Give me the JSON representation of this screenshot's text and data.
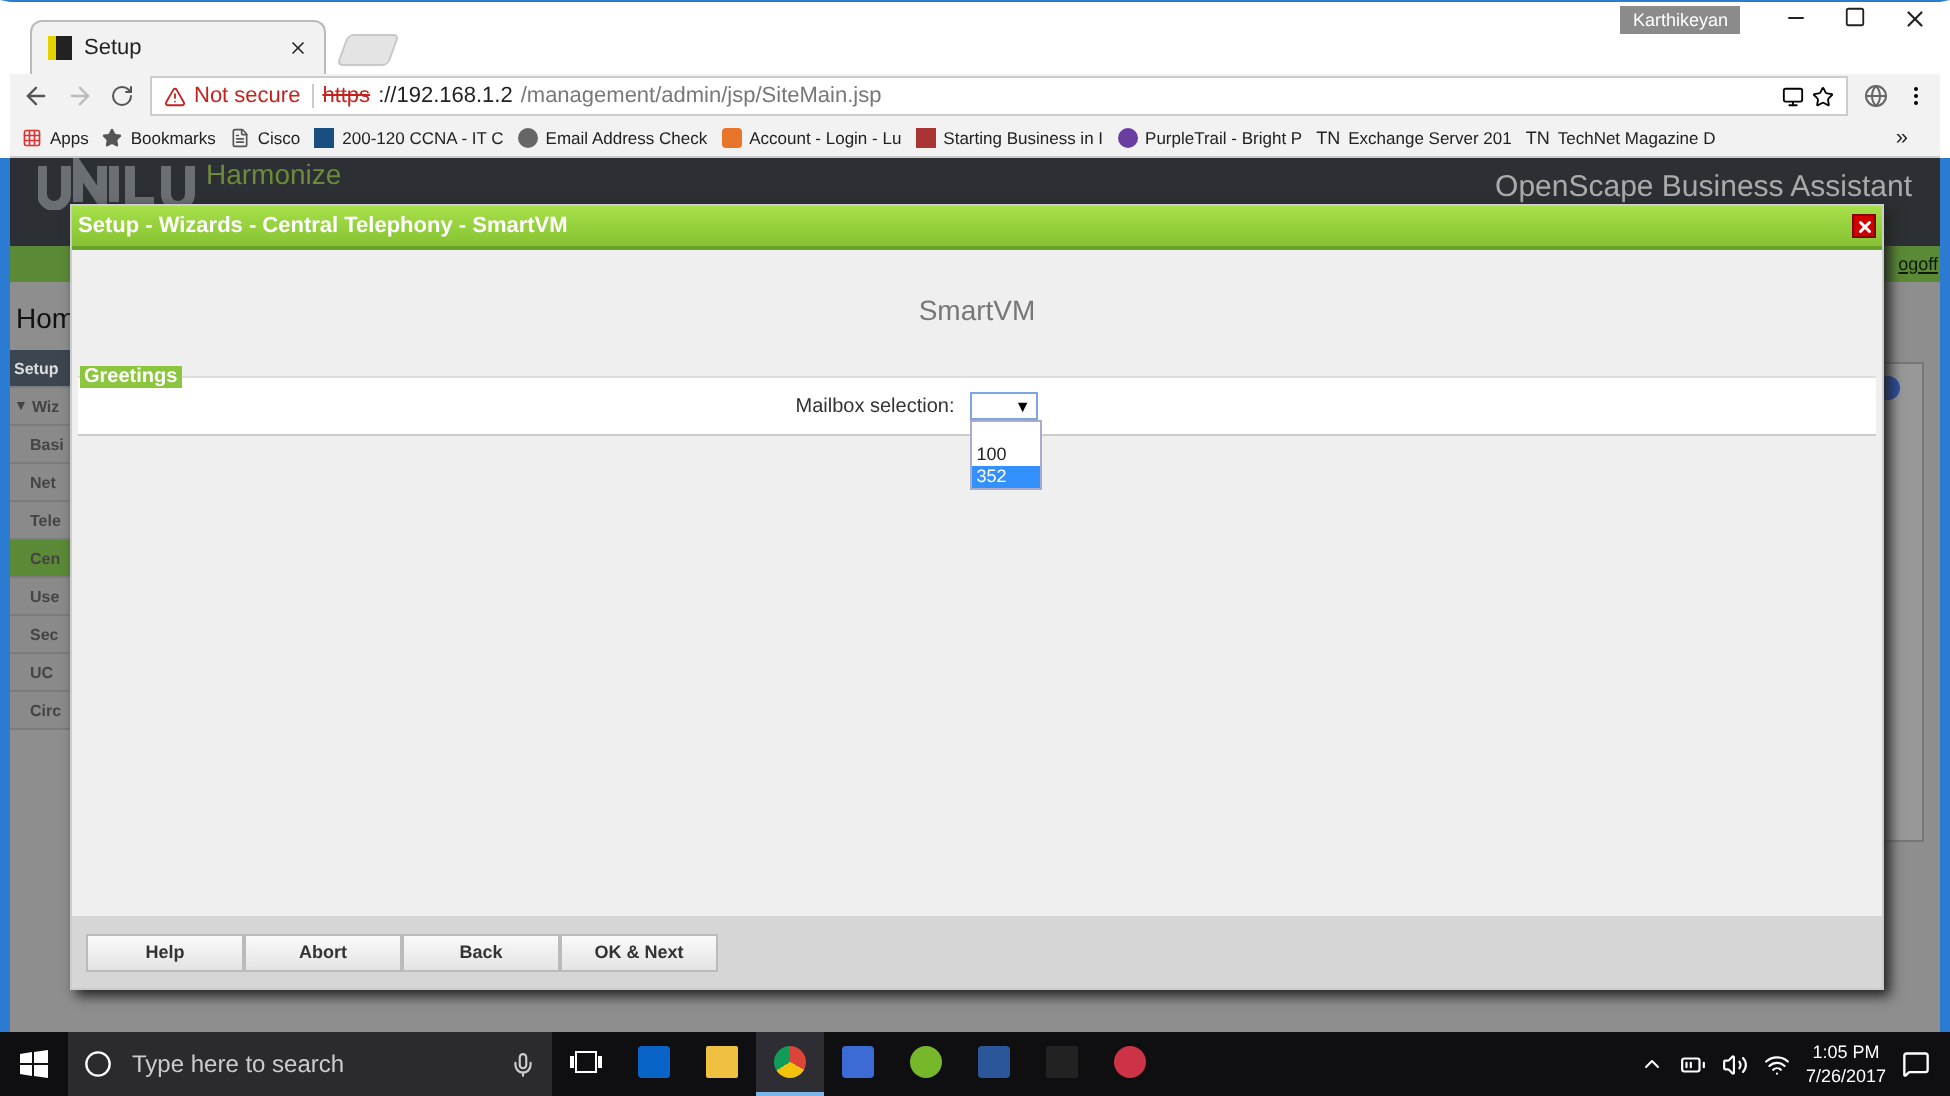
{
  "browser": {
    "tab": {
      "title": "Setup",
      "selected": true
    },
    "user": "Karthikeyan",
    "address": {
      "security": "Not secure",
      "scheme": "https",
      "host": "://192.168.1.2",
      "path": "/management/admin/jsp/SiteMain.jsp"
    },
    "bookmarks": [
      {
        "label": "Apps",
        "kind": "apps"
      },
      {
        "label": "Bookmarks",
        "kind": "folder"
      },
      {
        "label": "Cisco",
        "kind": "page"
      },
      {
        "label": "200-120 CCNA - IT C",
        "kind": "cisco"
      },
      {
        "label": "Email Address Check",
        "kind": "blob"
      },
      {
        "label": "Account - Login - Lu",
        "kind": "orange"
      },
      {
        "label": "Starting Business in I",
        "kind": "tee"
      },
      {
        "label": "PurpleTrail - Bright P",
        "kind": "flower"
      },
      {
        "label": "Exchange Server 201",
        "icon_text": "TN"
      },
      {
        "label": "TechNet Magazine D",
        "icon_text": "TN"
      }
    ],
    "more": "»"
  },
  "page": {
    "brand": "Harmonize",
    "product": "OpenScape Business Assistant",
    "logoff": "ogoff",
    "home": "Hom",
    "sidebar": [
      {
        "label": "Setup",
        "kind": "header",
        "selected": false
      },
      {
        "label": "Wiz",
        "kind": "group",
        "toggle": "▼",
        "selected": false
      },
      {
        "label": "Basi",
        "kind": "item",
        "selected": false
      },
      {
        "label": "Net",
        "kind": "item",
        "selected": false
      },
      {
        "label": "Tele",
        "kind": "item",
        "selected": false
      },
      {
        "label": "Cen",
        "kind": "item",
        "selected": true
      },
      {
        "label": "Use",
        "kind": "item",
        "selected": false
      },
      {
        "label": "Sec",
        "kind": "item",
        "selected": false
      },
      {
        "label": "UC",
        "kind": "item",
        "selected": false
      },
      {
        "label": "Circ",
        "kind": "item",
        "selected": false
      }
    ]
  },
  "dialog": {
    "title": "Setup - Wizards - Central Telephony - SmartVM",
    "heading": "SmartVM",
    "section": "Greetings",
    "field": {
      "label": "Mailbox selection:",
      "arrow": "▼",
      "expanded": true,
      "options": [
        {
          "label": "100",
          "selected": false
        },
        {
          "label": "352",
          "selected": true
        }
      ]
    },
    "buttons": [
      "Help",
      "Abort",
      "Back",
      "OK & Next"
    ]
  },
  "taskbar": {
    "search": {
      "placeholder": "Type here to search"
    },
    "apps": [
      {
        "kind": "outlook",
        "active": false
      },
      {
        "kind": "explorer",
        "active": false
      },
      {
        "kind": "chrome",
        "active": true
      },
      {
        "kind": "network",
        "active": false
      },
      {
        "kind": "torrent",
        "active": false
      },
      {
        "kind": "word",
        "active": false
      },
      {
        "kind": "terminal",
        "active": false
      },
      {
        "kind": "snip",
        "active": false
      }
    ],
    "time": "1:05 PM",
    "date": "7/26/2017"
  }
}
